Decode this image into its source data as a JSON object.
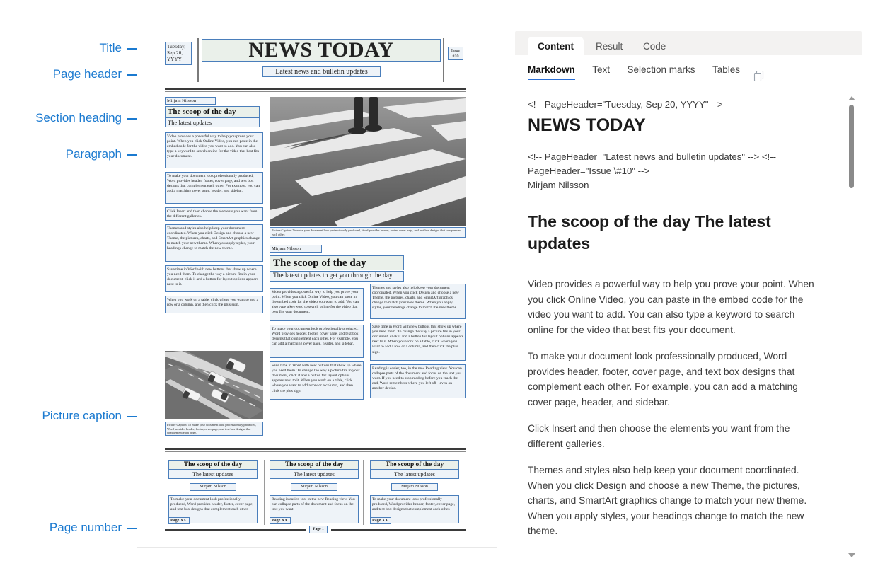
{
  "annotations": [
    {
      "id": "title",
      "label": "Title"
    },
    {
      "id": "page-header",
      "label": "Page header"
    },
    {
      "id": "section-heading",
      "label": "Section heading"
    },
    {
      "id": "paragraph",
      "label": "Paragraph"
    },
    {
      "id": "picture-caption",
      "label": "Picture caption"
    },
    {
      "id": "page-number",
      "label": "Page number"
    }
  ],
  "annotation_color": "#1b7ad0",
  "document": {
    "masthead": {
      "date": "Tuesday, Sep 20, YYYY",
      "date_lines": [
        "Tuesday,",
        "Sep 20,",
        "YYYY"
      ],
      "title": "NEWS TODAY",
      "issue_lines": [
        "Issue",
        "#10"
      ],
      "subtitle": "Latest news and bulletin updates"
    },
    "section1": {
      "author": "Mirjam Nilsson",
      "heading": "The scoop of the day",
      "subheading": "The latest updates",
      "paragraphs": [
        "Video provides a powerful way to help you prove your point. When you click Online Video, you can paste in the embed code for the video you want to add. You can also type a keyword to search online for the video that best fits your document.",
        "To make your document look professionally produced, Word provides header, footer, cover page, and text box designs that complement each other. For example, you can add a matching cover page, header, and sidebar.",
        "Click Insert and then choose the elements you want from the different galleries.",
        "Themes and styles also help keep your document coordinated. When you click Design and choose a new Theme, the pictures, charts, and SmartArt graphics change to match your new theme. When you apply styles, your headings change to match the new theme.",
        "Save time in Word with new buttons that show up where you need them. To change the way a picture fits in your document, click it and a button for layout options appears next to it.",
        "When you work on a table, click where you want to add a row or a column, and then click the plus sign."
      ],
      "caption": "Picture Caption: To make your document look professionally produced, Word provides header, footer, cover page, and text box designs that complement each other."
    },
    "section2": {
      "author": "Mirjam Nilsson",
      "heading": "The scoop of the day",
      "subheading": "The latest updates to get you through the day",
      "col_left": [
        "Video provides a powerful way to help you prove your point. When you click Online Video, you can paste in the embed code for the video you want to add. You can also type a keyword to search online for the video that best fits your document.",
        "To make your document look professionally produced, Word provides header, footer, cover page, and text box designs that complement each other. For example, you can add a matching cover page, header, and sidebar.",
        "Save time in Word with new buttons that show up where you need them. To change the way a picture fits in your document, click it and a button for layout options appears next to it. When you work on a table, click where you want to add a row or a column, and then click the plus sign."
      ],
      "col_right": [
        "Themes and styles also help keep your document coordinated. When you click Design and choose a new Theme, the pictures, charts, and SmartArt graphics change to match your new theme. When you apply styles, your headings change to match the new theme.",
        "Save time in Word with new buttons that show up where you need them. To change the way a picture fits in your document, click it and a button for layout options appears next to it. When you work on a table, click where you want to add a row or a column, and then click the plus sign.",
        "Reading is easier, too, in the new Reading view. You can collapse parts of the document and focus on the text you want. If you need to stop reading before you reach the end, Word remembers where you left off - even on another device."
      ],
      "caption": "Picture Caption: To make your document look professionally produced, Word provides header, footer, cover page, and text box designs that complement each other."
    },
    "bottom_columns": [
      {
        "heading": "The scoop of the day",
        "subheading": "The latest updates",
        "author": "Mirjam Nilsson",
        "body": "To make your document look professionally produced, Word provides header, footer, cover page, and text box designs that complement each other.",
        "page_label": "Page XX"
      },
      {
        "heading": "The scoop of the day",
        "subheading": "The latest updates",
        "author": "Mirjam Nilsson",
        "body": "Reading is easier, too, in the new Reading view. You can collapse parts of the document and focus on the text you want.",
        "page_label": "Page XX"
      },
      {
        "heading": "The scoop of the day",
        "subheading": "The latest updates",
        "author": "Mirjam Nilsson",
        "body": "To make your document look professionally produced, Word provides header, footer, cover page, and text box designs that complement each other.",
        "page_label": "Page XX"
      }
    ],
    "page_number": "Page 1"
  },
  "right_panel": {
    "tabs": [
      {
        "label": "Content",
        "active": true
      },
      {
        "label": "Result",
        "active": false
      },
      {
        "label": "Code",
        "active": false
      }
    ],
    "subtabs": [
      {
        "label": "Markdown",
        "active": true
      },
      {
        "label": "Text",
        "active": false
      },
      {
        "label": "Selection marks",
        "active": false
      },
      {
        "label": "Tables",
        "active": false
      }
    ],
    "copy_icon": "copy-icon",
    "accent_color": "#2a6fd6",
    "markdown": {
      "comment1": "<!-- PageHeader=\"Tuesday, Sep 20, YYYY\" -->",
      "h1": "NEWS TODAY",
      "comment2": "<!-- PageHeader=\"Latest news and bulletin updates\" --> <!-- PageHeader=\"Issue \\#10\" -->",
      "author": "Mirjam Nilsson",
      "h2": "The scoop of the day The latest updates",
      "paragraphs": [
        "Video provides a powerful way to help you prove your point. When you click Online Video, you can paste in the embed code for the video you want to add. You can also type a keyword to search online for the video that best fits your document.",
        "To make your document look professionally produced, Word provides header, footer, cover page, and text box designs that complement each other. For example, you can add a matching cover page, header, and sidebar.",
        "Click Insert and then choose the elements you want from the different galleries.",
        "Themes and styles also help keep your document coordinated. When you click Design and choose a new Theme, the pictures, charts, and SmartArt graphics change to match your new theme. When you apply styles, your headings change to match the new theme."
      ]
    }
  }
}
